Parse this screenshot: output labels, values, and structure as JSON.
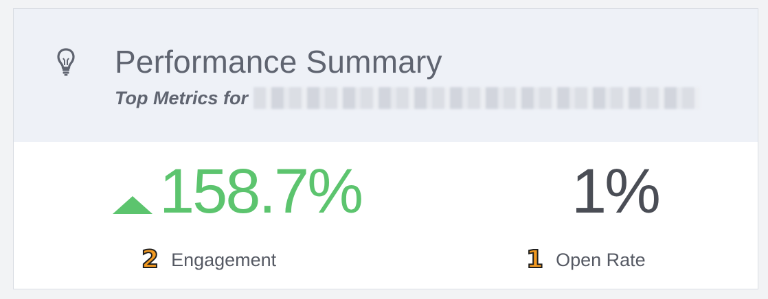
{
  "header": {
    "title": "Performance Summary",
    "subtitle": "Top Metrics for",
    "icon": "lightbulb-icon"
  },
  "metrics": [
    {
      "value": "158.7%",
      "trend": "up",
      "rank": "2",
      "label": "Engagement",
      "color": "#5cc46e"
    },
    {
      "value": "1%",
      "rank": "1",
      "label": "Open Rate",
      "color": "#4a4d55"
    }
  ],
  "colors": {
    "header_bg": "#eef1f7",
    "accent_green": "#5cc46e",
    "rank_badge": "#f39a21"
  }
}
